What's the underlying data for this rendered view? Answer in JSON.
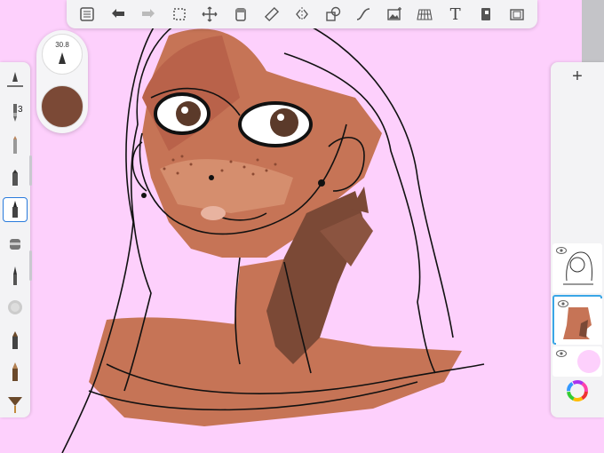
{
  "toolbar": {
    "items": [
      "list-icon",
      "undo-icon",
      "redo-icon",
      "select-icon",
      "transform-icon",
      "fill-icon",
      "ruler-icon",
      "symmetry-icon",
      "shapes-icon",
      "curve-icon",
      "image-icon",
      "perspective-icon",
      "text",
      "flipbook-icon",
      "fullscreen-icon"
    ],
    "text_tool_label": "T"
  },
  "left_tools": {
    "brush_count": "3",
    "active_tool": "ink-pen"
  },
  "brush_puck": {
    "size_value": "30.8",
    "color": "#7b4936"
  },
  "layers": {
    "add_label": "+",
    "selected_index": 1,
    "items": [
      "line-art-layer",
      "skin-color-layer",
      "background-layer"
    ],
    "background_color": "#fdd0fc"
  },
  "colors": {
    "canvas_bg": "#fdd0fc",
    "skin": "#c27050",
    "skin_light": "#d98f6b",
    "shadow": "#7b4936",
    "accent": "#3aa6e6"
  }
}
